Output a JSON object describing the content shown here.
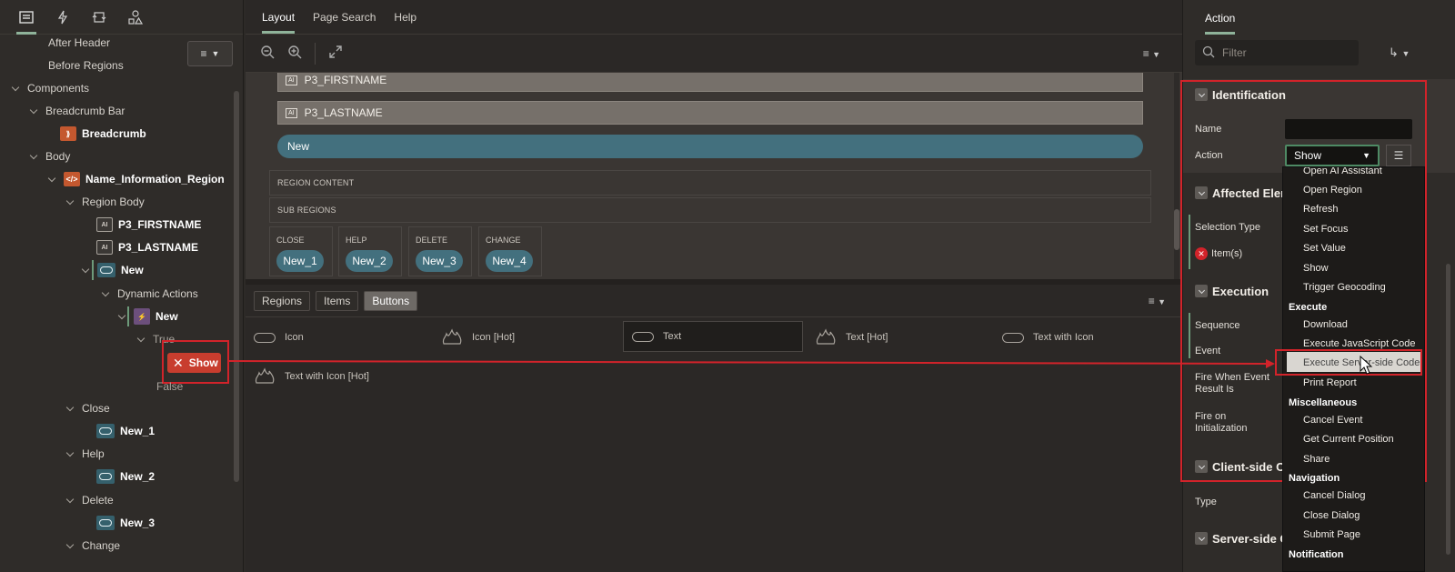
{
  "left_panel": {
    "menu_tree": [
      {
        "label": "After Header"
      },
      {
        "label": "Before Regions"
      },
      {
        "label": "Components"
      },
      {
        "label": "Breadcrumb Bar"
      },
      {
        "label": "Breadcrumb"
      },
      {
        "label": "Body"
      },
      {
        "label": "Name_Information_Region"
      },
      {
        "label": "Region Body"
      },
      {
        "label": "P3_FIRSTNAME"
      },
      {
        "label": "P3_LASTNAME"
      },
      {
        "label": "New"
      },
      {
        "label": "Dynamic Actions"
      },
      {
        "label": "New"
      },
      {
        "label": "True"
      },
      {
        "label": "Show"
      },
      {
        "label": "False"
      },
      {
        "label": "Close"
      },
      {
        "label": "New_1"
      },
      {
        "label": "Help"
      },
      {
        "label": "New_2"
      },
      {
        "label": "Delete"
      },
      {
        "label": "New_3"
      },
      {
        "label": "Change"
      }
    ],
    "item_icon_text": "AI"
  },
  "center": {
    "tabs": [
      "Layout",
      "Page Search",
      "Help"
    ],
    "canvas": {
      "items": [
        "P3_FIRSTNAME",
        "P3_LASTNAME"
      ],
      "item_icon_text": "AI",
      "new_button": "New",
      "region_content": "REGION CONTENT",
      "sub_regions": "SUB REGIONS",
      "buttons": [
        {
          "label": "CLOSE",
          "name": "New_1"
        },
        {
          "label": "HELP",
          "name": "New_2"
        },
        {
          "label": "DELETE",
          "name": "New_3"
        },
        {
          "label": "CHANGE",
          "name": "New_4"
        }
      ]
    },
    "gallery_tabs": [
      "Regions",
      "Items",
      "Buttons"
    ],
    "gallery_items": [
      "Icon",
      "Icon [Hot]",
      "Text",
      "Text [Hot]",
      "Text with Icon",
      "Text with Icon [Hot]"
    ]
  },
  "right_panel": {
    "tab": "Action",
    "filter_placeholder": "Filter",
    "sections": {
      "identification": "Identification",
      "affected": "Affected Elem",
      "execution": "Execution",
      "client": "Client-side Co",
      "server": "Server-side Co"
    },
    "labels": {
      "name": "Name",
      "action": "Action",
      "selection_type": "Selection Type",
      "items": "Item(s)",
      "sequence": "Sequence",
      "event": "Event",
      "fire_when": "Fire When Event Result Is",
      "fire_init": "Fire on Initialization",
      "type": "Type"
    },
    "action_value": "Show"
  },
  "dropdown": {
    "items": [
      {
        "type": "item",
        "label": "Open AI Assistant"
      },
      {
        "type": "item",
        "label": "Open Region"
      },
      {
        "type": "item",
        "label": "Refresh"
      },
      {
        "type": "item",
        "label": "Set Focus"
      },
      {
        "type": "item",
        "label": "Set Value"
      },
      {
        "type": "item",
        "label": "Show"
      },
      {
        "type": "item",
        "label": "Trigger Geocoding"
      },
      {
        "type": "header",
        "label": "Execute"
      },
      {
        "type": "item",
        "label": "Download"
      },
      {
        "type": "item",
        "label": "Execute JavaScript Code"
      },
      {
        "type": "item",
        "label": "Execute Server-side Code",
        "selected": true
      },
      {
        "type": "item",
        "label": "Print Report"
      },
      {
        "type": "header",
        "label": "Miscellaneous"
      },
      {
        "type": "item",
        "label": "Cancel Event"
      },
      {
        "type": "item",
        "label": "Get Current Position"
      },
      {
        "type": "item",
        "label": "Share"
      },
      {
        "type": "header",
        "label": "Navigation"
      },
      {
        "type": "item",
        "label": "Cancel Dialog"
      },
      {
        "type": "item",
        "label": "Close Dialog"
      },
      {
        "type": "item",
        "label": "Submit Page"
      },
      {
        "type": "header",
        "label": "Notification"
      }
    ]
  },
  "colors": {
    "accent": "#8fb39a",
    "highlight": "#d2232a",
    "button": "#43707e",
    "dynamic_action": "#6c4f7c",
    "region": "#c4582f"
  }
}
